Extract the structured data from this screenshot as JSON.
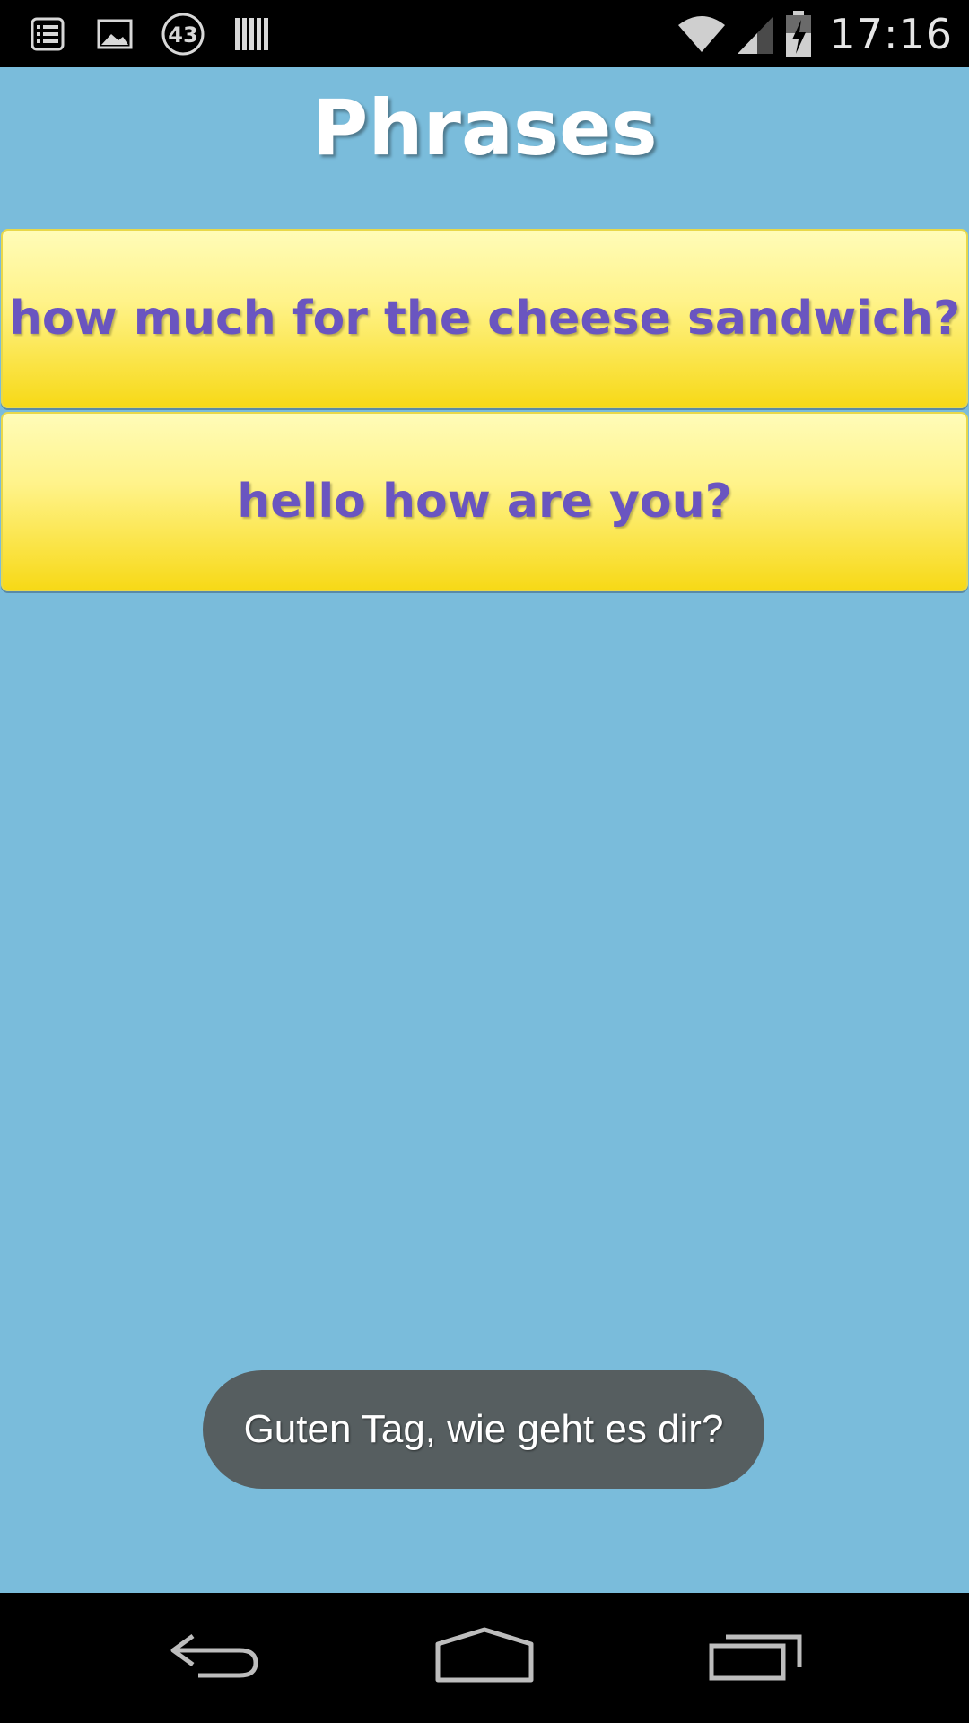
{
  "status_bar": {
    "notification_icons": [
      "task-list-icon",
      "image-icon",
      "badge-43-icon",
      "barcode-icon"
    ],
    "badge_count": "43",
    "system_icons": [
      "wifi-icon",
      "cell-signal-icon",
      "battery-charging-icon"
    ],
    "time": "17:16"
  },
  "app": {
    "title": "Phrases",
    "background_color": "#7abcdb",
    "phrases": [
      {
        "label": "how much for the cheese sandwich?"
      },
      {
        "label": "hello how are you?"
      }
    ]
  },
  "toast": {
    "message": "Guten Tag, wie geht es dir?"
  },
  "nav_bar": {
    "buttons": [
      "back-icon",
      "home-icon",
      "recent-apps-icon"
    ]
  }
}
